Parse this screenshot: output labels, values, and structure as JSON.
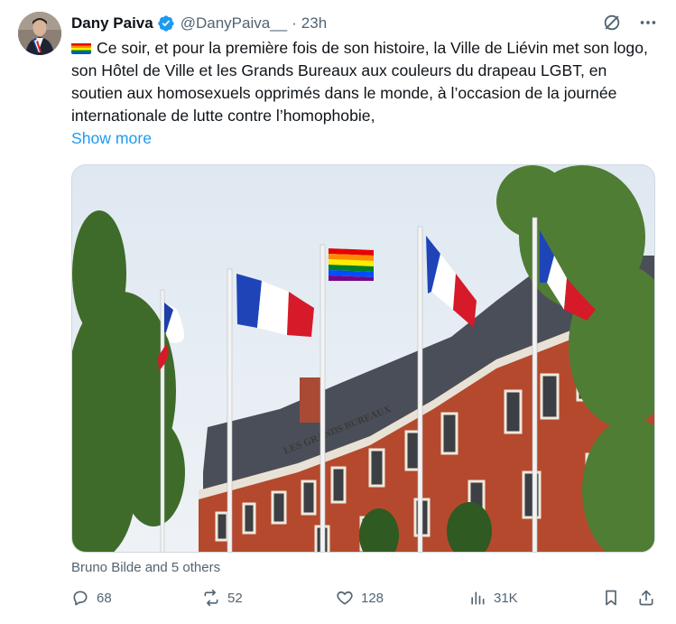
{
  "tweet": {
    "author_name": "Dany Paiva",
    "handle": "@DanyPaiva__",
    "separator": "·",
    "time": "23h",
    "text": "Ce soir, et pour la première fois de son histoire, la Ville de Liévin met son logo, son Hôtel de Ville et les Grands Bureaux aux couleurs du drapeau LGBT, en soutien aux homosexuels opprimés dans le monde, à l’occasion de la journée internationale de lutte contre l’homophobie,",
    "show_more": "Show more",
    "media_building_sign": "LES GRANDS BUREAUX",
    "liked_by": "Bruno Bilde and 5 others"
  },
  "actions": {
    "replies": "68",
    "reposts": "52",
    "likes": "128",
    "views": "31K"
  },
  "icons": {
    "verified": "verified-badge-icon",
    "grok": "grok-icon",
    "more": "more-icon",
    "reply": "reply-icon",
    "repost": "repost-icon",
    "like": "heart-icon",
    "views": "views-icon",
    "bookmark": "bookmark-icon",
    "share": "share-icon",
    "emoji": "rainbow-flag-emoji"
  },
  "colors": {
    "link": "#1d9bf0",
    "secondary": "#536471",
    "verified": "#1d9bf0"
  }
}
